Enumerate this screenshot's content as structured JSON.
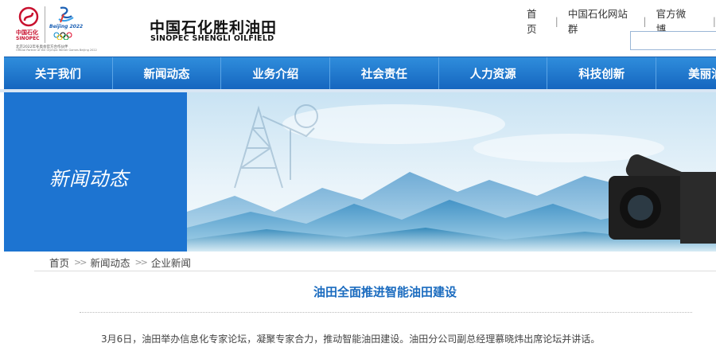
{
  "header": {
    "sinopec_cn": "中国石化",
    "sinopec_en": "SINOPEC",
    "beijing_logo_text": "Beijing 2022",
    "partner_text": "北京2022年冬奥会官方合作伙伴",
    "partner_text_en": "Official Partner of the Olympic Winter Games Beijing 2022",
    "brand_cn": "中国石化胜利油田",
    "brand_en": "SINOPEC SHENGLI OILFIELD",
    "links": [
      "首页",
      "中国石化网站群",
      "官方微博"
    ]
  },
  "search": {
    "placeholder": ""
  },
  "nav": {
    "items": [
      "关于我们",
      "新闻动态",
      "业务介绍",
      "社会责任",
      "人力资源",
      "科技创新",
      "美丽油"
    ]
  },
  "banner": {
    "title": "新闻动态"
  },
  "breadcrumb": {
    "items": [
      "首页",
      "新闻动态",
      "企业新闻"
    ],
    "separator": ">>"
  },
  "article": {
    "title": "油田全面推进智能油田建设",
    "first_paragraph": "3月6日，油田举办信息化专家论坛，凝聚专家合力，推动智能油田建设。油田分公司副总经理慕晓炜出席论坛并讲话。"
  },
  "colors": {
    "nav_blue": "#1d74d1",
    "title_blue": "#1a6bbf",
    "brand_red": "#c8102e"
  }
}
